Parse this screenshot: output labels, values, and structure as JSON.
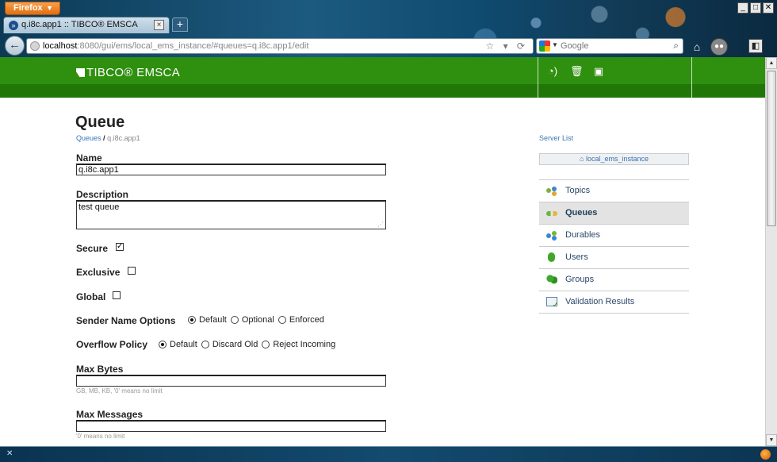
{
  "browser": {
    "menu_button": "Firefox",
    "tab_title": "q.i8c.app1 :: TIBCO® EMSCA",
    "new_tab": "+",
    "url_host": "localhost",
    "url_rest": ":8080/gui/ems/local_ems_instance/#queues=q.i8c.app1/edit",
    "search_placeholder": "Google",
    "window_controls": [
      "_",
      "□",
      "✕"
    ]
  },
  "header": {
    "logo_text": "TIBCO® EMSCA",
    "tools": [
      "broadcast-icon",
      "trash-icon",
      "save-icon"
    ]
  },
  "page": {
    "title": "Queue",
    "breadcrumb_link": "Queues",
    "breadcrumb_sep": "/",
    "breadcrumb_current": "q.i8c.app1"
  },
  "form": {
    "name_label": "Name",
    "name_value": "q.i8c.app1",
    "description_label": "Description",
    "description_value": "test queue",
    "secure_label": "Secure",
    "secure_checked": true,
    "exclusive_label": "Exclusive",
    "exclusive_checked": false,
    "global_label": "Global",
    "global_checked": false,
    "sender_name_label": "Sender Name Options",
    "sender_name_options": [
      "Default",
      "Optional",
      "Enforced"
    ],
    "sender_name_selected": "Default",
    "overflow_label": "Overflow Policy",
    "overflow_options": [
      "Default",
      "Discard Old",
      "Reject Incoming"
    ],
    "overflow_selected": "Default",
    "max_bytes_label": "Max Bytes",
    "max_bytes_value": "",
    "max_bytes_hint": "GB, MB, KB, '0' means no limit",
    "max_messages_label": "Max Messages",
    "max_messages_value": "",
    "max_messages_hint": "'0' means no limit"
  },
  "sidebar": {
    "server_list_link": "Server List",
    "instance_name": "local_ems_instance",
    "items": [
      {
        "label": "Topics",
        "icon": "topics-icon"
      },
      {
        "label": "Queues",
        "icon": "queues-icon",
        "active": true
      },
      {
        "label": "Durables",
        "icon": "durables-icon"
      },
      {
        "label": "Users",
        "icon": "users-icon"
      },
      {
        "label": "Groups",
        "icon": "groups-icon"
      },
      {
        "label": "Validation Results",
        "icon": "validation-icon"
      }
    ]
  },
  "colors": {
    "header_green": "#2f8f0f",
    "header_band": "#217608",
    "link_blue": "#3a75b5",
    "active_item_bg": "#e3e3e3"
  }
}
